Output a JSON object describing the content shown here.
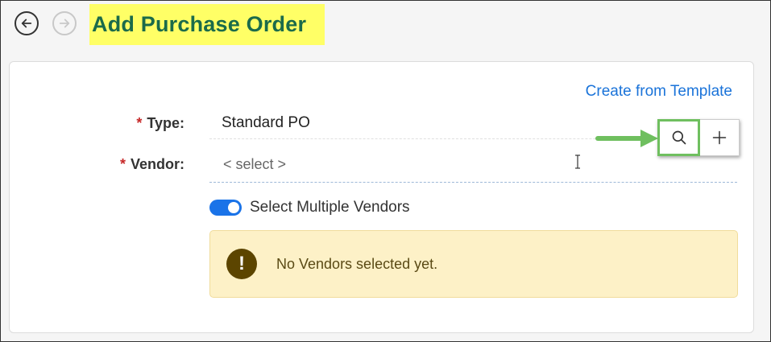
{
  "header": {
    "title": "Add Purchase Order",
    "back_icon": "arrow-left-circle-icon",
    "forward_icon": "arrow-right-circle-icon"
  },
  "form": {
    "create_from_template": "Create from Template",
    "type": {
      "required_mark": "*",
      "label": "Type:",
      "value": "Standard PO"
    },
    "vendor": {
      "required_mark": "*",
      "label": "Vendor:",
      "placeholder": "< select >"
    },
    "search_icon": "search-icon",
    "add_icon": "plus-icon",
    "multi_vendor": {
      "label": "Select Multiple Vendors",
      "enabled": true
    },
    "alert": {
      "icon": "!",
      "message": "No Vendors selected yet."
    }
  },
  "colors": {
    "title_highlight": "#ffff66",
    "title_text": "#1b6b4a",
    "link": "#1a73d9",
    "required": "#c62828",
    "toggle_on": "#1a73e8",
    "annotation_green": "#6fbf5f",
    "alert_bg": "#fdf1c7"
  }
}
